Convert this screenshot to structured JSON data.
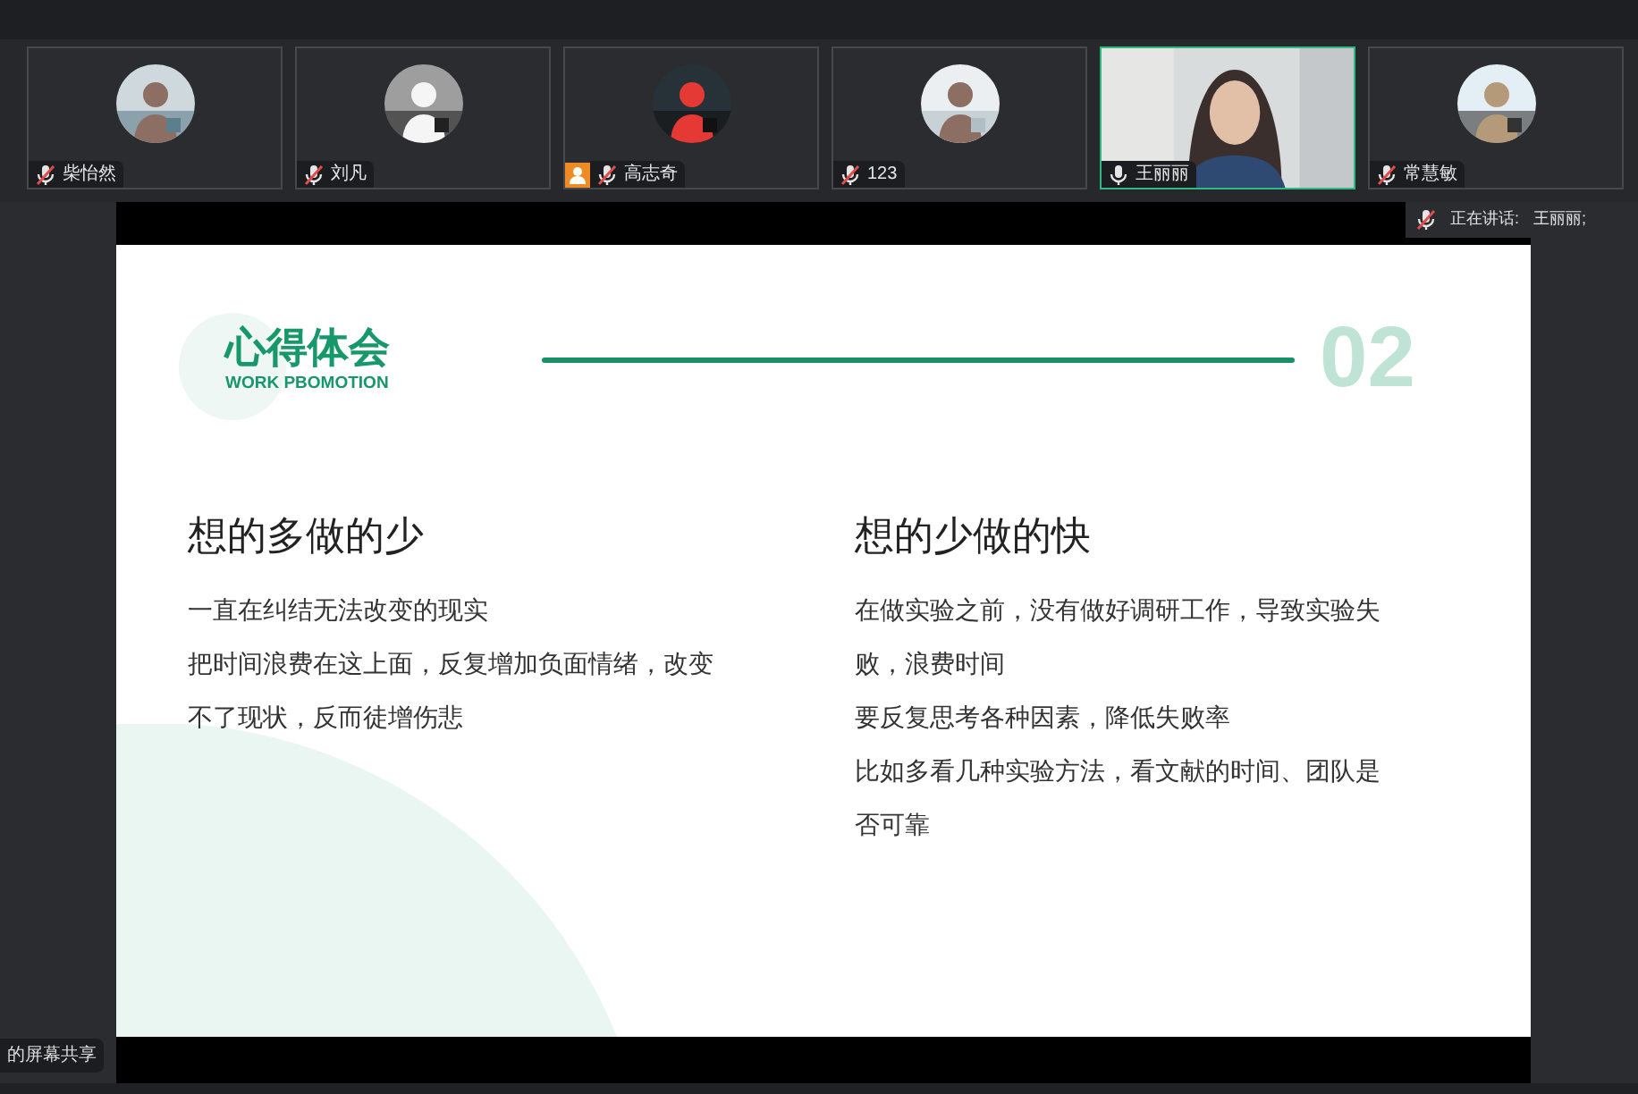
{
  "participants": [
    {
      "name": "柴怡然",
      "kind": "avatar",
      "muted": true,
      "active": false,
      "presenter_badge": false
    },
    {
      "name": "刘凡",
      "kind": "avatar",
      "muted": true,
      "active": false,
      "presenter_badge": false
    },
    {
      "name": "高志奇",
      "kind": "avatar",
      "muted": true,
      "active": false,
      "presenter_badge": true
    },
    {
      "name": "123",
      "kind": "avatar",
      "muted": true,
      "active": false,
      "presenter_badge": false
    },
    {
      "name": "王丽丽",
      "kind": "video",
      "muted": false,
      "active": true,
      "presenter_badge": false
    },
    {
      "name": "常慧敏",
      "kind": "avatar",
      "muted": true,
      "active": false,
      "presenter_badge": false
    }
  ],
  "speaking": {
    "label": "正在讲话:",
    "name": "王丽丽;"
  },
  "slide": {
    "title": "心得体会",
    "subtitle": "WORK PBOMOTION",
    "number": "02",
    "columns": [
      {
        "heading": "想的多做的少",
        "paragraphs": [
          "一直在纠结无法改变的现实",
          "把时间浪费在这上面，反复增加负面情绪，改变不了现状，反而徒增伤悲"
        ]
      },
      {
        "heading": "想的少做的快",
        "paragraphs": [
          "在做实验之前，没有做好调研工作，导致实验失败，浪费时间",
          "要反复思考各种因素，降低失败率",
          "比如多看几种实验方法，看文献的时间、团队是否可靠"
        ]
      }
    ]
  },
  "share_label": "的屏幕共享"
}
